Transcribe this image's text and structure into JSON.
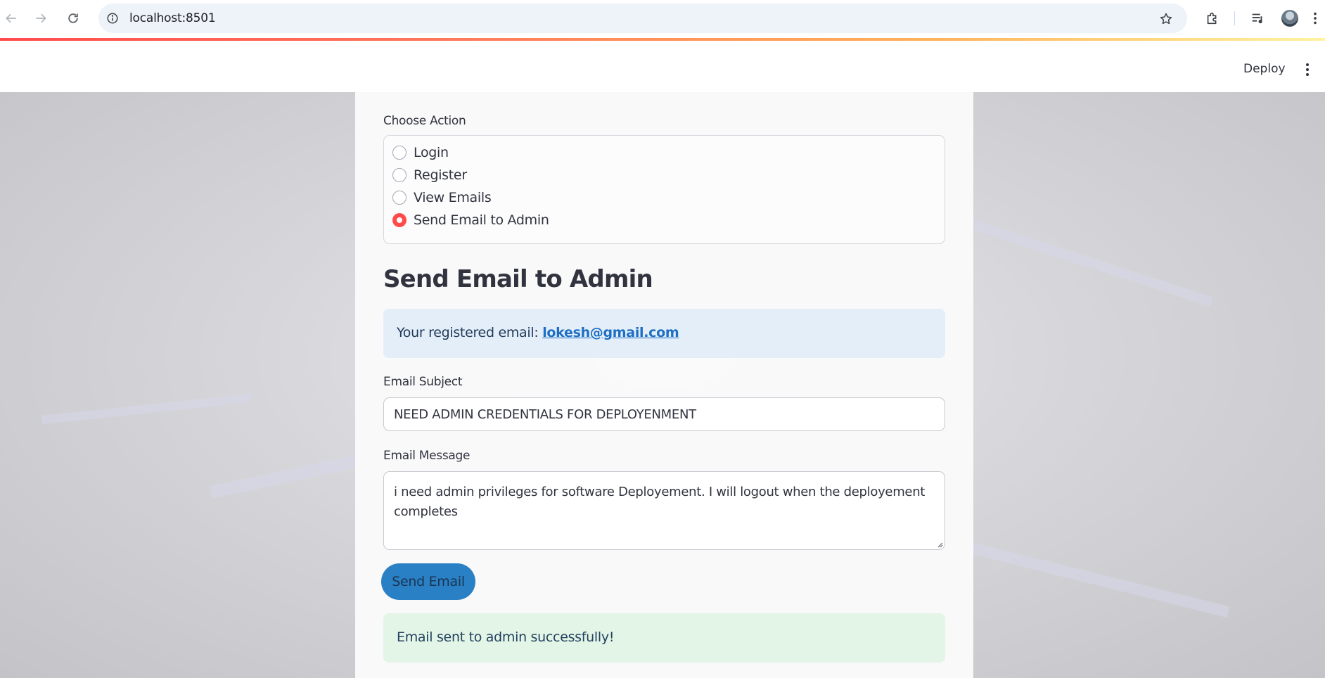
{
  "browser": {
    "url": "localhost:8501",
    "icons": {
      "back": "back-arrow-icon",
      "forward": "forward-arrow-icon",
      "reload": "reload-icon",
      "site_info": "site-info-icon",
      "bookmark": "star-icon",
      "extensions": "puzzle-icon",
      "media": "media-queue-icon",
      "profile": "avatar",
      "menu": "kebab-menu-icon"
    }
  },
  "app_header": {
    "deploy_label": "Deploy",
    "menu_icon": "kebab-menu-icon"
  },
  "choose_action": {
    "label": "Choose Action",
    "options": [
      {
        "label": "Login",
        "selected": false
      },
      {
        "label": "Register",
        "selected": false
      },
      {
        "label": "View Emails",
        "selected": false
      },
      {
        "label": "Send Email to Admin",
        "selected": true
      }
    ]
  },
  "section": {
    "title": "Send Email to Admin"
  },
  "info": {
    "prefix": "Your registered email: ",
    "email": "lokesh@gmail.com"
  },
  "subject": {
    "label": "Email Subject",
    "value": "NEED ADMIN CREDENTIALS FOR DEPLOYENMENT"
  },
  "message": {
    "label": "Email Message",
    "value": "i need admin privileges for software Deployement. I will logout when the deployement completes"
  },
  "send_button": {
    "label": "Send Email"
  },
  "success": {
    "text": "Email sent to admin successfully!"
  },
  "colors": {
    "accent": "#ff4b4b",
    "primary_button": "#2980c4",
    "info_bg": "#e4eef9",
    "success_bg": "#e3f5e6",
    "text": "#31333f"
  }
}
